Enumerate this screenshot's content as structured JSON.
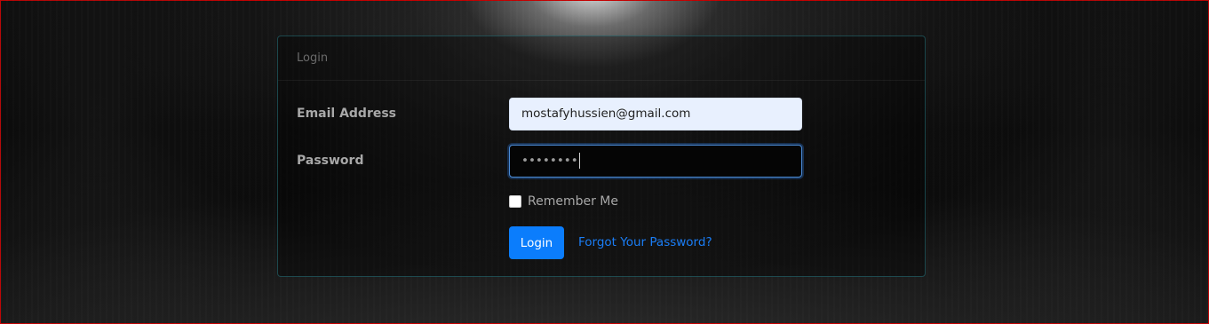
{
  "card": {
    "header": "Login"
  },
  "form": {
    "email_label": "Email Address",
    "email_value": "mostafyhussien@gmail.com",
    "password_label": "Password",
    "password_masked": "••••••••",
    "remember_label": "Remember Me",
    "remember_checked": false,
    "login_button": "Login",
    "forgot_link": "Forgot Your Password?"
  },
  "colors": {
    "primary": "#0b7dfc",
    "link": "#1a7df5",
    "frame_border": "#c40000"
  }
}
